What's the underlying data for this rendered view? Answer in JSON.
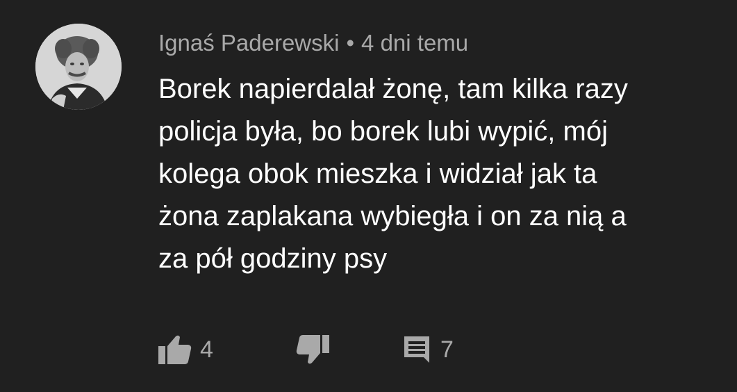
{
  "comment": {
    "author": "Ignaś Paderewski",
    "separator": "•",
    "timestamp": "4 dni temu",
    "text_lines": [
      "Borek napierdalał żonę,  tam kilka razy",
      "policja była, bo borek lubi wypić, mój",
      "kolega obok mieszka i widział jak ta",
      "żona zaplakana wybiegła i on za nią a",
      "za pół godziny psy"
    ]
  },
  "actions": {
    "like_icon": "thumbs-up-icon",
    "like_count": "4",
    "dislike_icon": "thumbs-down-icon",
    "reply_icon": "comment-icon",
    "reply_count": "7"
  },
  "colors": {
    "background": "#202020",
    "text": "#ffffff",
    "secondary_text": "#a9a9a9"
  }
}
